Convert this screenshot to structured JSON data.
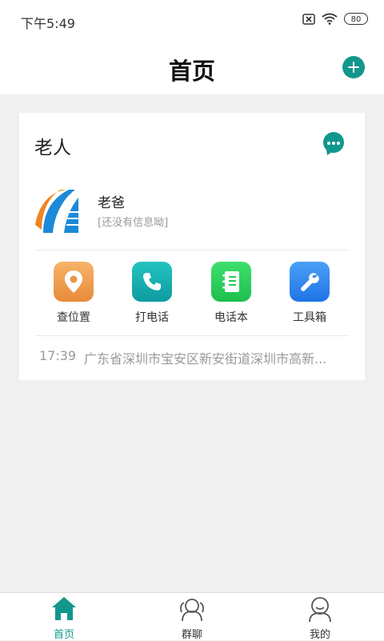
{
  "status_bar": {
    "time": "下午5:49",
    "battery": "80"
  },
  "header": {
    "title": "首页"
  },
  "card": {
    "title": "老人",
    "member": {
      "name": "老爸",
      "status": "[还没有信息呦]"
    },
    "actions": [
      {
        "label": "查位置",
        "icon": "location-pin-icon",
        "color": "#ef9d4c"
      },
      {
        "label": "打电话",
        "icon": "phone-icon",
        "color": "#16aab0"
      },
      {
        "label": "电话本",
        "icon": "notebook-icon",
        "color": "#2ecc5c"
      },
      {
        "label": "工具箱",
        "icon": "wrench-icon",
        "color": "#2f86f0"
      }
    ],
    "location": {
      "time": "17:39",
      "address": "广东省深圳市宝安区新安街道深圳市高新..."
    }
  },
  "tabbar": {
    "tabs": [
      {
        "label": "首页",
        "icon": "home-icon",
        "active": true
      },
      {
        "label": "群聊",
        "icon": "group-chat-icon",
        "active": false
      },
      {
        "label": "我的",
        "icon": "profile-icon",
        "active": false
      }
    ]
  },
  "colors": {
    "accent": "#12978c",
    "background": "#f0f0f0",
    "muted_text": "#999999"
  }
}
